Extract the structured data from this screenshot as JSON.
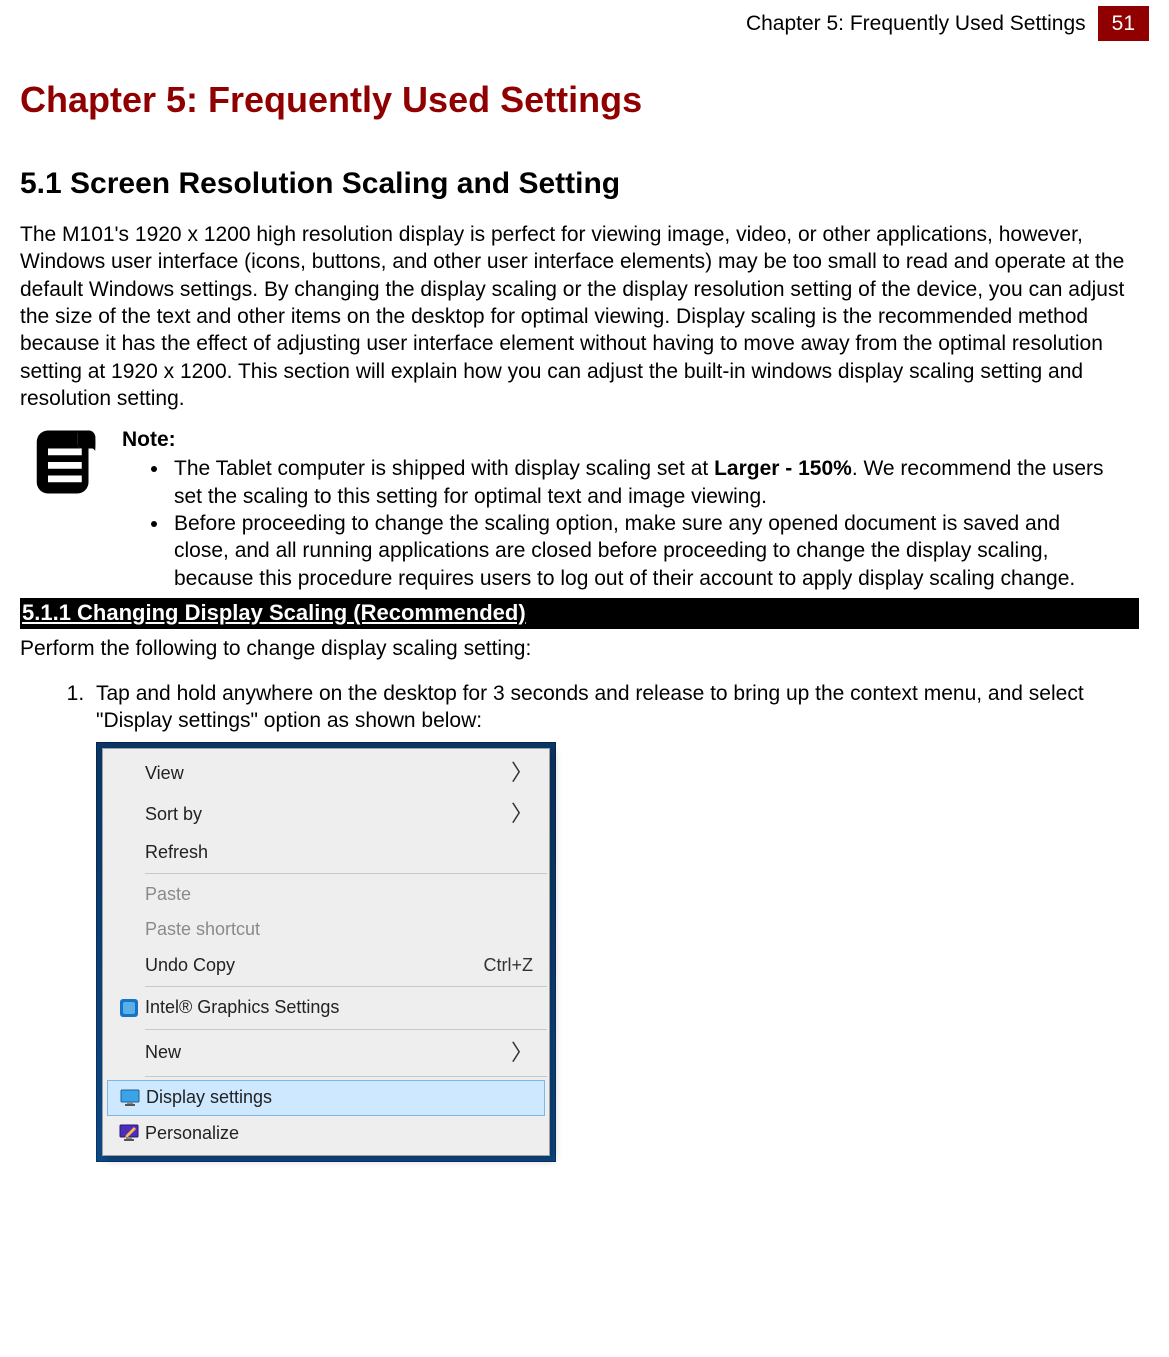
{
  "header": {
    "running_title": "Chapter 5: Frequently Used Settings",
    "page_number": "51"
  },
  "chapter_title": "Chapter 5: Frequently Used Settings",
  "section": {
    "title": "5.1 Screen Resolution Scaling and Setting",
    "intro": "The M101's 1920 x 1200 high resolution display is perfect for viewing image, video, or other applications, however, Windows user interface (icons, buttons, and other user interface elements) may be too small to read and operate at the default Windows settings. By changing the display scaling or the display resolution setting of the device, you can adjust the size of the text and other items on the desktop for optimal viewing. Display scaling is the recommended method because it has the effect of adjusting user interface element without having to move away from the optimal resolution setting at 1920 x 1200. This section will explain how you can adjust the built-in windows display scaling setting and resolution setting."
  },
  "note": {
    "label": "Note:",
    "items": [
      {
        "pre": "The Tablet computer is shipped with display scaling set at ",
        "bold": "Larger - 150%",
        "post": ". We recommend the users set the scaling to this setting for optimal text and image viewing."
      },
      {
        "pre": "Before proceeding to change the scaling option, make sure any opened document is saved and close, and all running applications are closed before proceeding to change the display scaling, because this procedure requires users to log out of their account to apply display scaling change.",
        "bold": "",
        "post": ""
      }
    ]
  },
  "subsection": {
    "title": "5.1.1 Changing Display Scaling (Recommended)",
    "intro": "Perform the following to change display scaling setting:",
    "step1": "Tap and hold anywhere on the desktop for 3 seconds and release to bring up the context menu, and select \"Display settings\" option as shown below:"
  },
  "context_menu": {
    "items": [
      {
        "label": "View",
        "submenu": true
      },
      {
        "label": "Sort by",
        "submenu": true
      },
      {
        "label": "Refresh"
      },
      {
        "sep": true
      },
      {
        "label": "Paste",
        "disabled": true
      },
      {
        "label": "Paste shortcut",
        "disabled": true
      },
      {
        "label": "Undo Copy",
        "shortcut": "Ctrl+Z"
      },
      {
        "sep": true
      },
      {
        "label": "Intel® Graphics Settings",
        "icon": "intel"
      },
      {
        "sep": true
      },
      {
        "label": "New",
        "submenu": true
      },
      {
        "sep": true
      },
      {
        "label": "Display settings",
        "icon": "display",
        "highlight": true
      },
      {
        "label": "Personalize",
        "icon": "personalize"
      }
    ]
  }
}
